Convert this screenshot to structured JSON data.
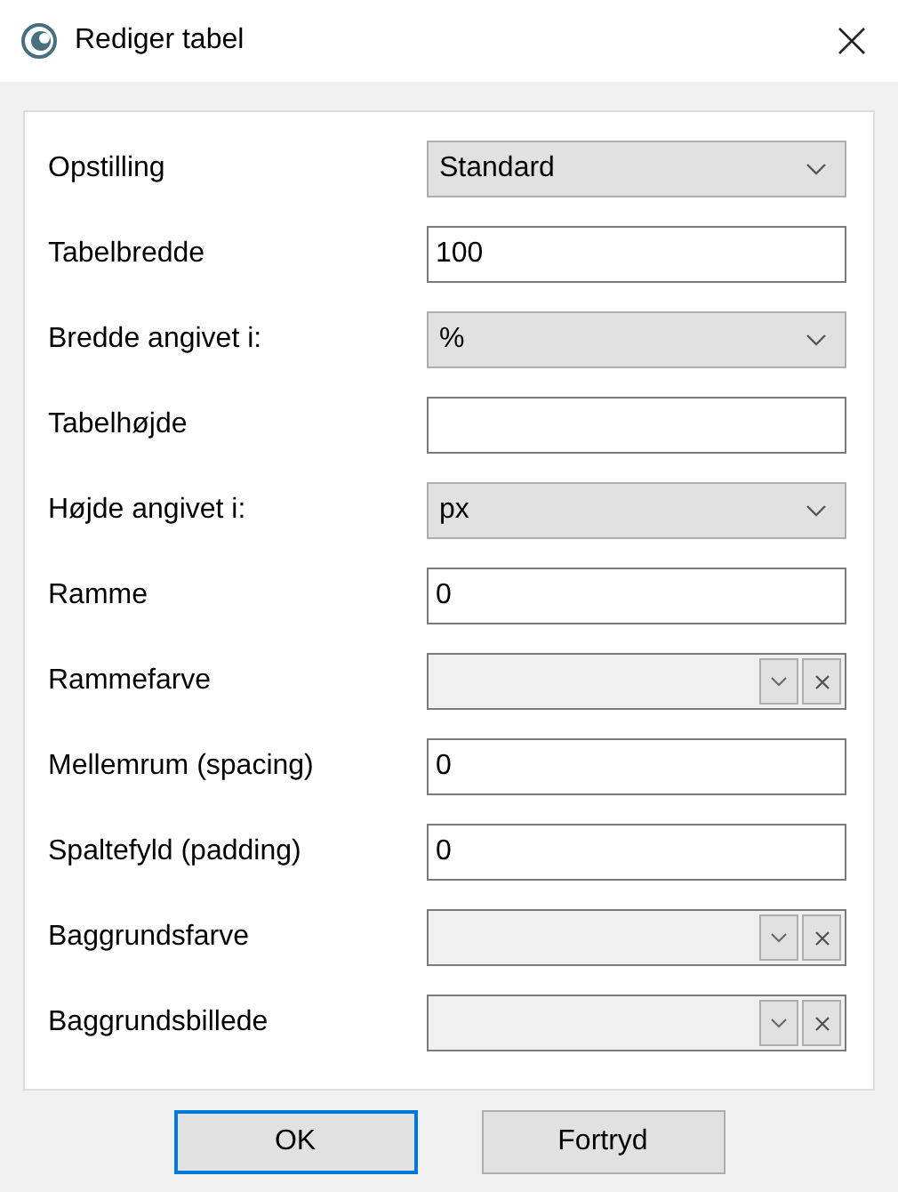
{
  "window": {
    "title": "Rediger tabel"
  },
  "fields": [
    {
      "label": "Opstilling",
      "kind": "select",
      "value": "Standard"
    },
    {
      "label": "Tabelbredde",
      "kind": "text",
      "value": "100"
    },
    {
      "label": "Bredde angivet i:",
      "kind": "select",
      "value": "%"
    },
    {
      "label": "Tabelhøjde",
      "kind": "text"
    },
    {
      "label": "Højde angivet i:",
      "kind": "select",
      "value": "px"
    },
    {
      "label": "Ramme",
      "kind": "text",
      "value": "0"
    },
    {
      "label": "Rammefarve",
      "kind": "color"
    },
    {
      "label": "Mellemrum (spacing)",
      "kind": "text",
      "value": "0"
    },
    {
      "label": "Spaltefyld (padding)",
      "kind": "text",
      "value": "0"
    },
    {
      "label": "Baggrundsfarve",
      "kind": "color"
    },
    {
      "label": "Baggrundsbillede",
      "kind": "color"
    }
  ],
  "buttons": [
    {
      "label": "OK",
      "focused": true
    },
    {
      "label": "Fortryd",
      "focused": false
    }
  ]
}
